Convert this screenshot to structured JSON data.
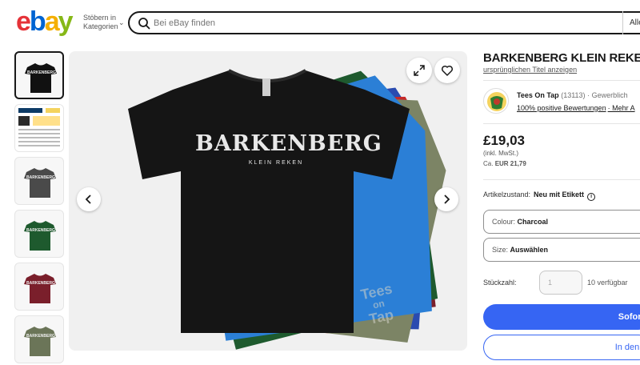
{
  "header": {
    "logo": {
      "e": "e",
      "b": "b",
      "a": "a",
      "y": "y"
    },
    "categories_line1": "Stöbern in",
    "categories_line2": "Kategorien",
    "search_placeholder": "Bei eBay finden",
    "search_category": "Alle"
  },
  "gallery": {
    "thumbnails": [
      {
        "color": "#111111",
        "label": "BARKENBERG",
        "active": true
      },
      {
        "color": "#f5f5f5",
        "label": "T-SHIRT SIZING",
        "active": false
      },
      {
        "color": "#4a4a4a",
        "label": "BARKENBERG",
        "active": false
      },
      {
        "color": "#1e5a2e",
        "label": "BARKENBERG",
        "active": false
      },
      {
        "color": "#7a1f2b",
        "label": "BARKENBERG",
        "active": false
      },
      {
        "color": "#6b7558",
        "label": "BARKENBERG",
        "active": false
      }
    ],
    "main_shirt_text": "BARKENBERG",
    "main_shirt_subtext": "KLEIN REKEN",
    "watermark_line1": "Tees",
    "watermark_line2": "on",
    "watermark_line3": "Tap"
  },
  "product": {
    "title": "BARKENBERG KLEIN REKEN",
    "original_title_link": "ursprünglichen Titel anzeigen",
    "seller": {
      "name": "Tees On Tap",
      "score": "(13113)",
      "type": "· Gewerblich",
      "feedback": "100% positive Bewertungen",
      "more": "· Mehr A"
    },
    "price": "£19,03",
    "vat": "(inkl. MwSt.)",
    "approx_prefix": "Ca.",
    "approx_value": "EUR 21,79",
    "condition_label": "Artikelzustand:",
    "condition_value": "Neu mit Etikett",
    "colour_label": "Colour:",
    "colour_value": "Charcoal",
    "size_label": "Size:",
    "size_value": "Auswählen",
    "quantity_label": "Stückzahl:",
    "quantity_value": "1",
    "quantity_available": "10 verfügbar",
    "buy_now_label": "Sofort",
    "cart_label": "In den"
  },
  "colors": {
    "primary": "#3665f3"
  }
}
